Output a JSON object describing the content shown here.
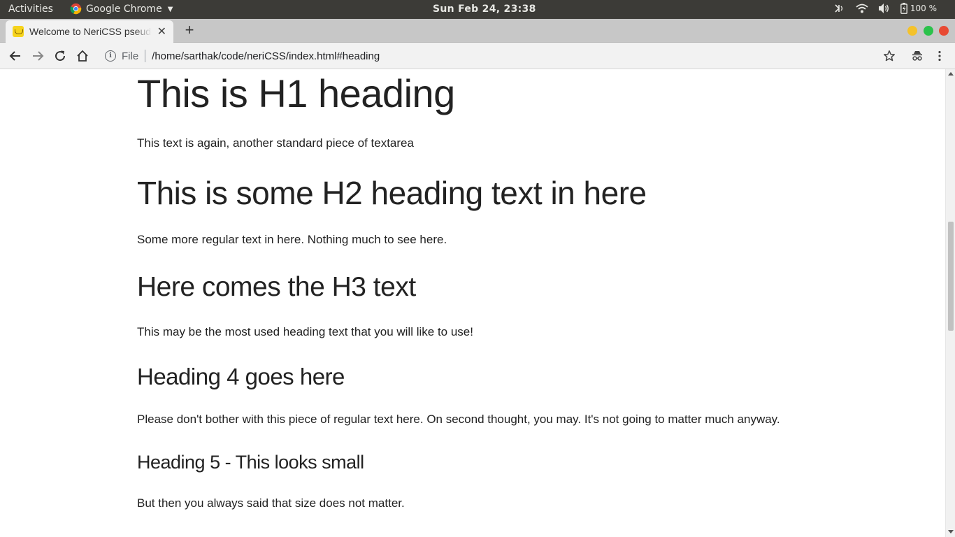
{
  "system_bar": {
    "activities_label": "Activities",
    "app_name": "Google Chrome",
    "clock": "Sun Feb 24, 23:38",
    "battery_percent": "100 %"
  },
  "browser": {
    "tab_title": "Welcome to NeriCSS pseudo",
    "scheme_label": "File",
    "url": "/home/sarthak/code/neriCSS/index.html#heading"
  },
  "page": {
    "h1": "This is H1 heading",
    "p1": "This text is again, another standard piece of textarea",
    "h2": "This is some H2 heading text in here",
    "p2": "Some more regular text in here. Nothing much to see here.",
    "h3": "Here comes the H3 text",
    "p3": "This may be the most used heading text that you will like to use!",
    "h4": "Heading 4 goes here",
    "p4": "Please don't bother with this piece of regular text here. On second thought, you may. It's not going to matter much anyway.",
    "h5": "Heading 5 - This looks small",
    "p5": "But then you always said that size does not matter."
  },
  "colors": {
    "topbar_bg": "#3c3b37",
    "tabstrip_bg": "#c7c7c7",
    "toolbar_bg": "#f2f2f2",
    "text": "#222222",
    "win_minimize": "#f4c22b",
    "win_maximize": "#2bc24b",
    "win_close": "#e84a33"
  },
  "icons": [
    "chrome-logo-icon",
    "caret-down-icon",
    "accessibility-icon",
    "wifi-icon",
    "volume-icon",
    "battery-icon",
    "favicon-icon",
    "close-icon",
    "plus-icon",
    "back-arrow-icon",
    "forward-arrow-icon",
    "reload-icon",
    "home-icon",
    "info-icon",
    "star-icon",
    "incognito-icon",
    "kebab-menu-icon"
  ]
}
